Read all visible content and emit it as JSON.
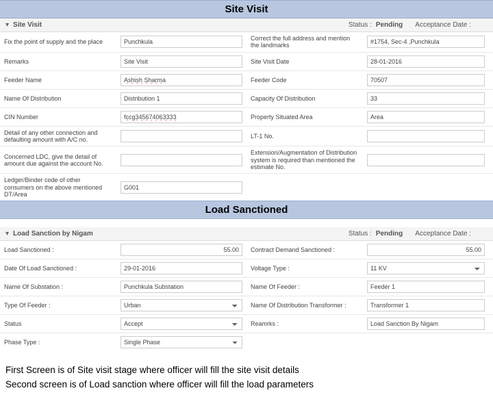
{
  "headings": {
    "site_visit": "Site Visit",
    "load_sanctioned": "Load Sanctioned"
  },
  "sv": {
    "panel_title": "Site Visit",
    "status_label": "Status :",
    "status_value": "Pending",
    "acc_label": "Acceptance Date :",
    "acc_value": "",
    "rows": {
      "fix_point_label": "Fix the point of supply and the place",
      "fix_point_value": "Punchkula",
      "correct_addr_label": "Correct the full address and mention the landmarks",
      "correct_addr_value": "#1754, Sec-4 ,Punchkula",
      "remarks_label": "Remarks",
      "remarks_value": "Site Visit",
      "sv_date_label": "Site Visit Date",
      "sv_date_value": "28-01-2016",
      "feeder_name_label": "Feeder Name",
      "feeder_name_value": "Ashish Sharma",
      "feeder_code_label": "Feeder Code",
      "feeder_code_value": "70507",
      "dist_name_label": "Name Of Distribution",
      "dist_name_value": "Distribution 1",
      "dist_cap_label": "Capacity Of Distribution",
      "dist_cap_value": "33",
      "cin_label": "CIN Number",
      "cin_value": "fccg345674063333",
      "prop_area_label": "Property Situated Area",
      "prop_area_value": "Area",
      "detail_conn_label": "Detail of any other connection and defaulting amount with A/C no.",
      "detail_conn_value": "",
      "lt1_label": "LT-1 No.",
      "lt1_value": "",
      "ldc_label": "Concerned LDC, give the detail of amount due against the account No.",
      "ldc_value": "",
      "ext_aug_label": "Extension/Augmentation of Distribution system is required than mentioned the estimate No.",
      "ext_aug_value": "",
      "ledger_label": "Ledger/Binder code of other consumers on the above mentioned DT/Area",
      "ledger_value": "G001"
    }
  },
  "ls": {
    "panel_title": "Load Sanction by Nigam",
    "status_label": "Status :",
    "status_value": "Pending",
    "acc_label": "Acceptance Date :",
    "acc_value": "",
    "rows": {
      "load_sanc_label": "Load Sanctioned :",
      "load_sanc_value": "55.00",
      "contract_label": "Contract Demand Sanctioned :",
      "contract_value": "55.00",
      "date_ls_label": "Date Of Load Sanctioned :",
      "date_ls_value": "29-01-2016",
      "voltage_label": "Voltage Type :",
      "voltage_value": "11 KV",
      "sub_name_label": "Name Of Substation :",
      "sub_name_value": "Punchkula Substation",
      "feeder_name_label": "Name Of Feeder :",
      "feeder_name_value": "Feeder 1",
      "feeder_type_label": "Type Of Feeder :",
      "feeder_type_value": "Urban",
      "dist_trans_label": "Name Of Distribution Transformer :",
      "dist_trans_value": "Transformer 1",
      "status_label": "Status",
      "status_value": "Accept",
      "remarks_label": "Reamrks :",
      "remarks_value": "Load Sanction By Nigam",
      "phase_label": "Phase Type :",
      "phase_value": "Single Phase"
    }
  },
  "footer": {
    "line1": "First Screen is of Site visit stage where officer will fill the site visit details",
    "line2": "Second screen is of Load sanction where officer will fill the load parameters"
  }
}
